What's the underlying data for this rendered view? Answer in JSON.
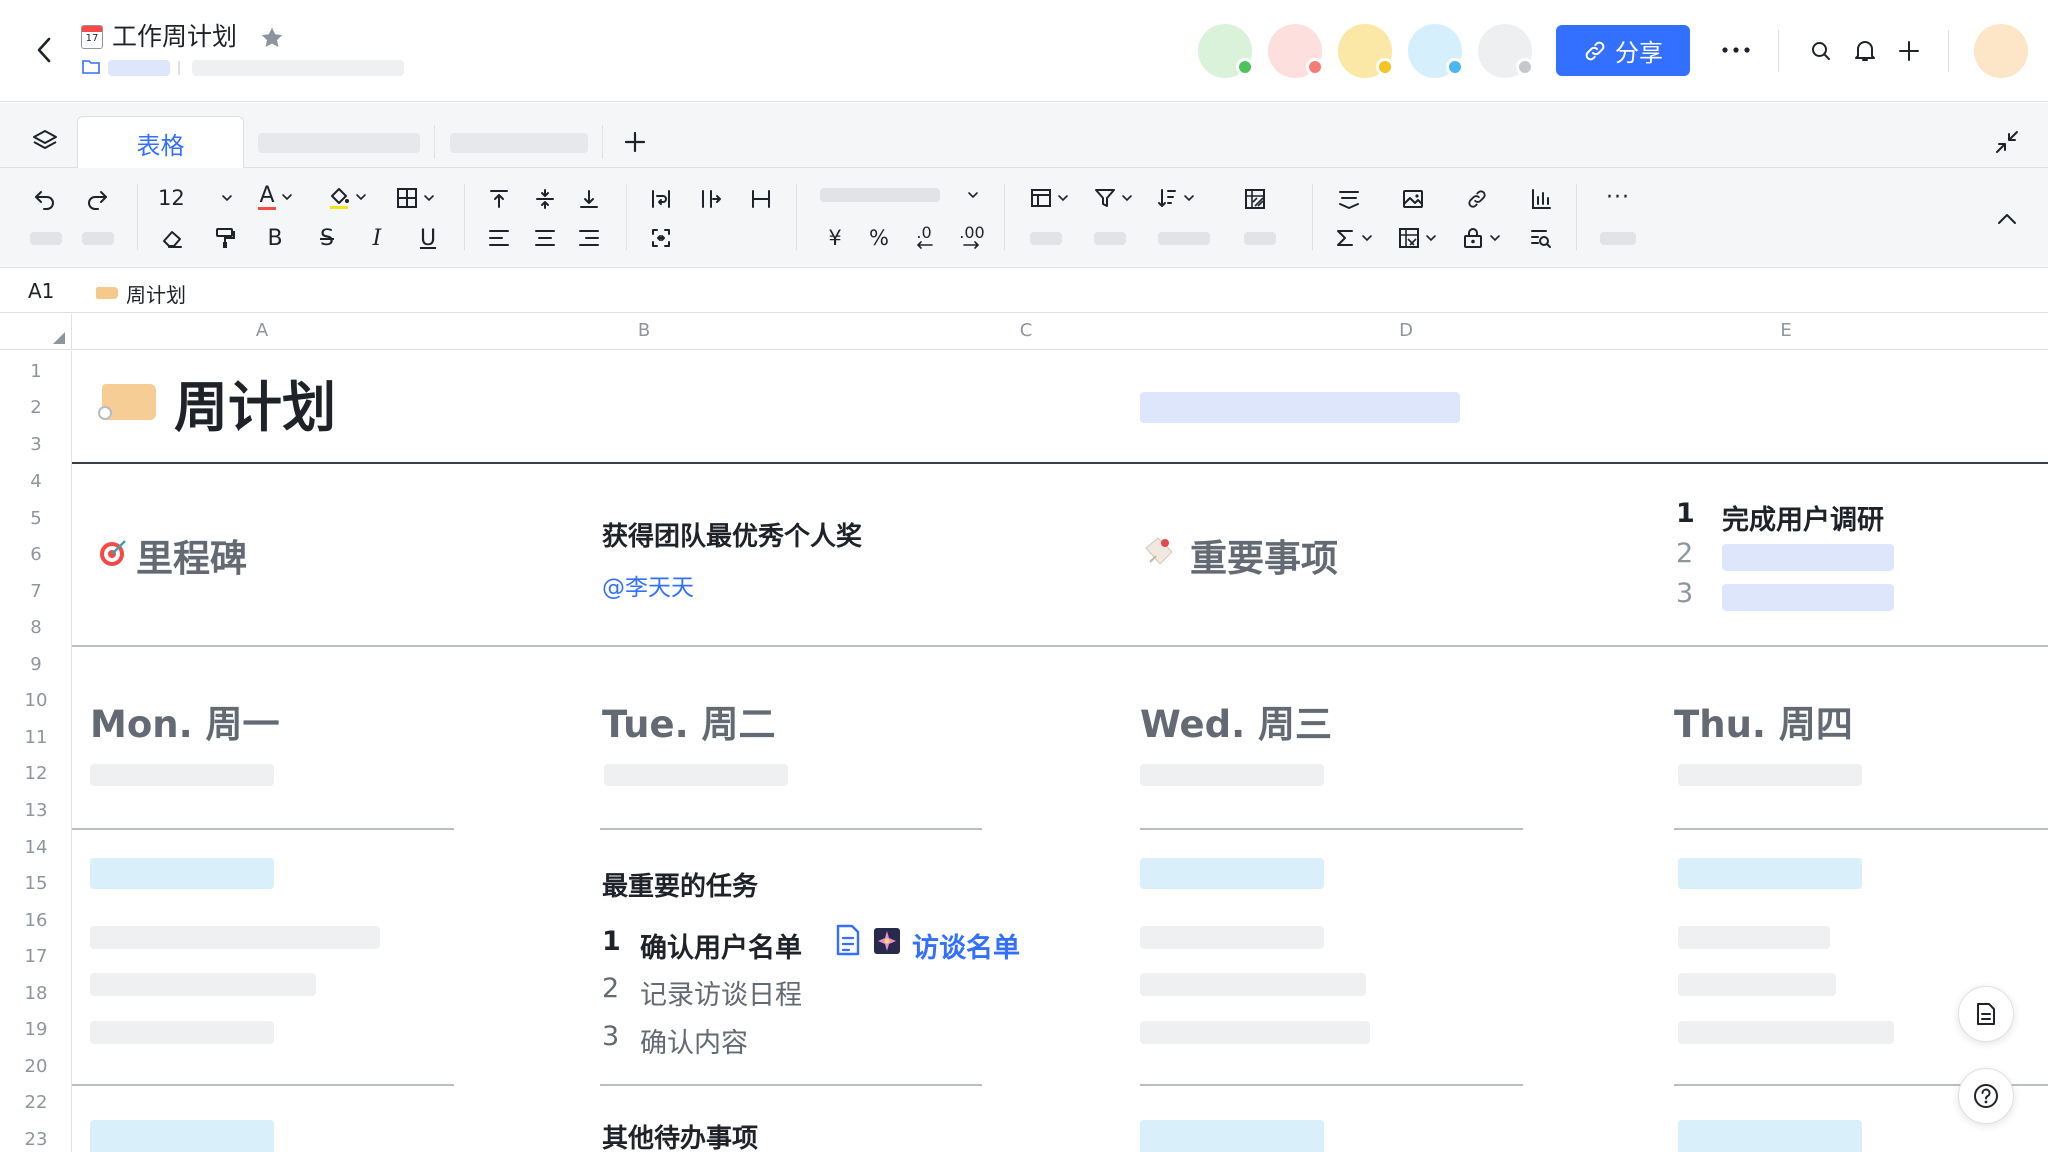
{
  "header": {
    "calendar_icon_text": "17",
    "title": "工作周计划",
    "share_label": "分享",
    "avatars": [
      {
        "color": "#d9f2d9",
        "dot": "#4fc35b"
      },
      {
        "color": "#fde0de",
        "dot": "#f57d77"
      },
      {
        "color": "#fbe7a6",
        "dot": "#f5c324"
      },
      {
        "color": "#d5f0fc",
        "dot": "#4ab7ef"
      },
      {
        "color": "#eeeff1",
        "dot": "#c4c7cc"
      }
    ]
  },
  "tabs": {
    "active_label": "表格"
  },
  "toolbar": {
    "font_size": "12",
    "text_color_glyph": "A",
    "bold": "B",
    "italic": "I",
    "underline": "U",
    "strike": "S",
    "currency": "¥",
    "percent": "%",
    "decrease_decimal": ".0",
    "increase_decimal": ".00",
    "more": "···"
  },
  "formula_bar": {
    "cell_ref": "A1",
    "content": "周计划"
  },
  "columns": [
    "A",
    "B",
    "C",
    "D",
    "E"
  ],
  "rows": [
    "1",
    "2",
    "3",
    "4",
    "5",
    "6",
    "7",
    "8",
    "9",
    "10",
    "11",
    "12",
    "13",
    "14",
    "15",
    "16",
    "17",
    "18",
    "19",
    "20",
    "22",
    "23"
  ],
  "sheet": {
    "title": "周计划",
    "milestone_label": "里程碑",
    "milestone_goal": "获得团队最优秀个人奖",
    "milestone_owner": "@李天天",
    "important_label": "重要事项",
    "important_items": [
      {
        "num": "1",
        "text": "完成用户调研"
      },
      {
        "num": "2"
      },
      {
        "num": "3"
      }
    ],
    "days": [
      "Mon. 周一",
      "Tue. 周二",
      "Wed. 周三",
      "Thu. 周四"
    ],
    "top_tasks_title": "最重要的任务",
    "top_tasks": [
      {
        "num": "1",
        "text": "确认用户名单",
        "link": "访谈名单"
      },
      {
        "num": "2",
        "text": "记录访谈日程"
      },
      {
        "num": "3",
        "text": "确认内容"
      }
    ],
    "other_todos_title": "其他待办事项"
  },
  "colors": {
    "accent": "#3370ff",
    "link": "#3370ff",
    "muted_text": "#646a73"
  }
}
